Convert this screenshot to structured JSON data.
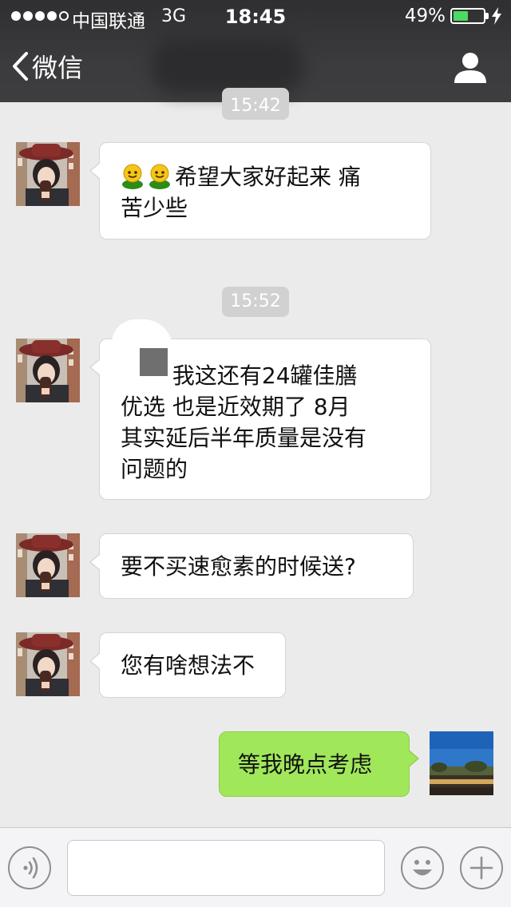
{
  "status_bar": {
    "carrier": "中国联通",
    "network": "3G",
    "time": "18:45",
    "battery_percent": "49%",
    "battery_level": 0.49,
    "signal_bars": 4,
    "signal_max": 5,
    "charging": true
  },
  "nav": {
    "back_label": "微信",
    "back_icon": "chevron-left-icon",
    "profile_icon": "person-icon"
  },
  "messages": [
    {
      "type": "timestamp",
      "text": "15:42"
    },
    {
      "type": "incoming",
      "emoji": [
        "smiley-emoji",
        "smiley-emoji"
      ],
      "lines": [
        "希望大家好起来 痛",
        "苦少些"
      ]
    },
    {
      "type": "timestamp",
      "text": "15:52"
    },
    {
      "type": "incoming",
      "lines": [
        "老师 我这还有24罐佳膳",
        "优选 也是近效期了 8月",
        "其实延后半年质量是没有",
        "问题的"
      ]
    },
    {
      "type": "incoming",
      "lines": [
        "要不买速愈素的时候送?"
      ]
    },
    {
      "type": "incoming",
      "lines": [
        "您有啥想法不"
      ]
    },
    {
      "type": "outgoing",
      "lines": [
        "等我晚点考虑"
      ]
    }
  ],
  "input_bar": {
    "voice_icon": "voice-icon",
    "text_value": "",
    "emoji_icon": "emoji-icon",
    "plus_icon": "plus-icon"
  },
  "colors": {
    "header_bg": "#3b3b3d",
    "chat_bg": "#ebebeb",
    "incoming_bubble": "#ffffff",
    "outgoing_bubble": "#a0e75a",
    "timestamp_bg": "#d1d1d1",
    "battery_fill": "#4cd964"
  }
}
